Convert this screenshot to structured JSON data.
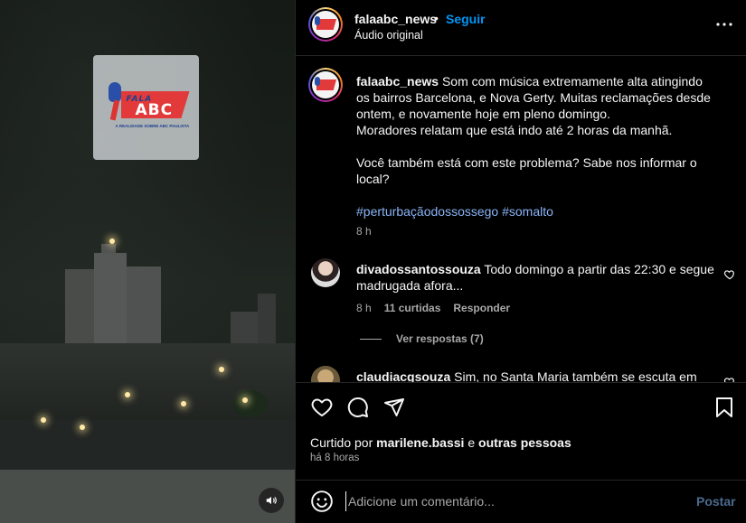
{
  "video": {
    "logo": {
      "line1": "FALA",
      "line2": "ABC",
      "tagline": "A REALIDADE SOBRE ABC PAULISTA"
    },
    "volume_icon": "speaker-icon"
  },
  "header": {
    "username": "falaabc_news",
    "dot": "•",
    "follow_label": "Seguir",
    "subtitle": "Áudio original",
    "more_icon": "more-horizontal-icon"
  },
  "caption": {
    "username": "falaabc_news",
    "text_1": "Som com música extremamente alta atingindo os bairros Barcelona, e Nova Gerty. Muitas reclamações desde ontem, e novamente hoje em pleno domingo.",
    "text_2": "Moradores relatam que está indo até 2 horas da manhã.",
    "text_3": "Você também está com este problema? Sabe nos informar o local?",
    "hashtags": "#perturbaçãodossossego #somalto",
    "time": "8 h"
  },
  "comments": [
    {
      "username": "divadossantossouza",
      "text": "Todo domingo a partir das 22:30 e segue madrugada afora...",
      "time": "8 h",
      "likes": "11 curtidas",
      "reply_label": "Responder",
      "view_replies": "Ver respostas (7)"
    },
    {
      "username": "claudiacgsouza",
      "text": "Sim, no Santa Maria também se escuta em alto"
    }
  ],
  "actions": {
    "liked_prefix": "Curtido por",
    "liked_user": "marilene.bassi",
    "liked_and": "e",
    "liked_others": "outras pessoas",
    "ago": "há 8 horas"
  },
  "composer": {
    "placeholder": "Adicione um comentário...",
    "post_label": "Postar"
  },
  "colors": {
    "link_blue": "#0095f6",
    "hashtag": "#8ab4f8",
    "muted": "#a8a8a8"
  }
}
